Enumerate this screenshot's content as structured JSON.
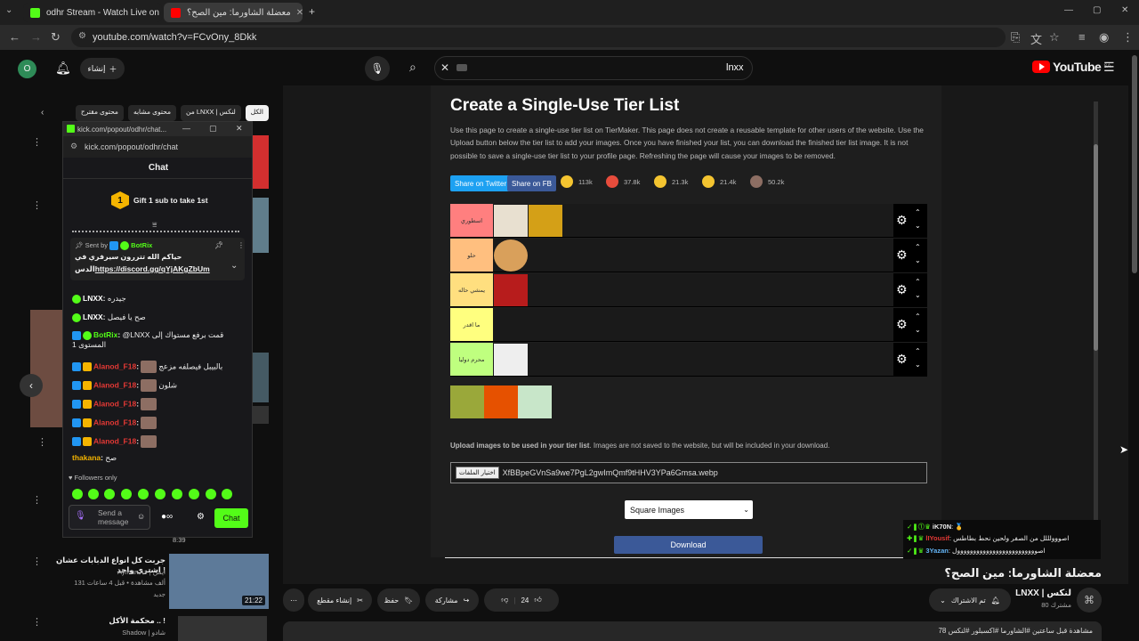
{
  "browser": {
    "tabs": [
      {
        "title": "odhr Stream - Watch Live on Ki"
      },
      {
        "title": "معضلة الشاورما: مين الصح؟"
      }
    ],
    "new_tab": "+",
    "url": "youtube.com/watch?v=FCvOny_8Dkk"
  },
  "youtube": {
    "avatar_letter": "O",
    "create_label": "إنشاء",
    "search_value": "lnxx",
    "logo": "YouTube",
    "region": "SA",
    "chips": [
      "الكل",
      "من LNXX | لنكس",
      "محتوى مشابه",
      "محتوى مقترح"
    ],
    "video_title": "معضلة الشاورما: مين الصح؟",
    "channel_name": "LNXX | لنكس",
    "subscribers": "80 مشترك",
    "subscribed_label": "تم الاشتراك",
    "likes": "24",
    "share_label": "مشاركة",
    "save_label": "حفظ",
    "clip_label": "إنشاء مقطع",
    "more": "⋯",
    "desc_line": "78 مشاهدة  قبل ساعتين  #الشاورما #اكسبلور #لنكس",
    "side_videos": [
      {
        "title": "جربت كل انواع الدبابات عشان اشتري واحد !",
        "channel": "Ayman Az | أيمن",
        "meta": "131 ألف مشاهدة • قبل 4 ساعات",
        "tag": "جديد",
        "duration": "21:22"
      },
      {
        "title": "محكمة الأكل .. !",
        "channel": "Shadow | شادو",
        "meta": "",
        "tag": "",
        "duration": ""
      }
    ],
    "side_durations": [
      "8:39"
    ]
  },
  "tiermaker": {
    "title": "Create a Single-Use Tier List",
    "description": "Use this page to create a single-use tier list on TierMaker. This page does not create a reusable template for other users of the website. Use the Upload button below the tier list to add your images. Once you have finished your list, you can download the finished tier list image. It is not possible to save a single-use tier list to your profile page. Refreshing the page will cause your images to be removed.",
    "share_twitter": "Share on Twitter",
    "share_fb": "Share on FB",
    "reactions": [
      "113k",
      "37.8k",
      "21.3k",
      "21.4k",
      "50.2k"
    ],
    "tiers": [
      {
        "label": "اسطوري",
        "color": "#ff7f7f",
        "items": 3
      },
      {
        "label": "حلو",
        "color": "#ffbf7f",
        "items": 1
      },
      {
        "label": "يمشي حاله",
        "color": "#ffdf7f",
        "items": 1
      },
      {
        "label": "ما اقدر",
        "color": "#ffff7f",
        "items": 0
      },
      {
        "label": "محرم دوليا",
        "color": "#bfff7f",
        "items": 1
      }
    ],
    "upload_label_bold": "Upload images to be used in your tier list",
    "upload_label_rest": ". Images are not saved to the website, but will be included in your download.",
    "file_button": "اختيار الملفات",
    "file_name": "XfBBpeGVnSa9we7PgL2gwImQmf9tHHV3YPa6Gmsa.webp",
    "select_value": "Square Images",
    "download": "Download"
  },
  "kick_popup": {
    "window_title": "kick.com/popout/odhr/chat...",
    "url": "kick.com/popout/odhr/chat",
    "header": "Chat",
    "gift_text": "Gift 1 sub to take 1st",
    "gift_rank": "1",
    "pinned_by_prefix": "Sent by",
    "pinned_by": "BotRix",
    "pinned_text": "حياكم الله تتررون سيرفري في",
    "pinned_link": "https://discord.gg/qYjAKgZbUm",
    "pinned_suffix": "الدس",
    "messages": [
      {
        "user": "LNXX",
        "text": "جيدره"
      },
      {
        "user": "LNXX",
        "text": "صح يا فيصل"
      },
      {
        "user": "BotRix",
        "text": "@LNXX قمت برفع مستواك إلى المستوى 1"
      },
      {
        "user": "Alanod_F18",
        "text": "بالبيبل فيصلفه مزعج"
      },
      {
        "user": "Alanod_F18",
        "text": "شلون"
      },
      {
        "user": "Alanod_F18",
        "text": ""
      },
      {
        "user": "Alanod_F18",
        "text": ""
      },
      {
        "user": "Alanod_F18",
        "text": ""
      },
      {
        "user": "thakana",
        "text": "صح"
      }
    ],
    "followers_only": "Followers only",
    "input_placeholder": "Send a message",
    "chat_button": "Chat"
  },
  "overlay_chat": [
    {
      "user": "iK70N",
      "text": ": 🥇"
    },
    {
      "user": "lIYousif",
      "text": ": اصووولللل من الصفر ولحين نحط بطاطس"
    },
    {
      "user": "3Yazan",
      "text": ": اصووووووووووووووووووووووووول"
    }
  ],
  "colors": {
    "kick_green": "#53fc18",
    "fb_blue": "#3b5998",
    "yt_red": "#ff0000"
  }
}
